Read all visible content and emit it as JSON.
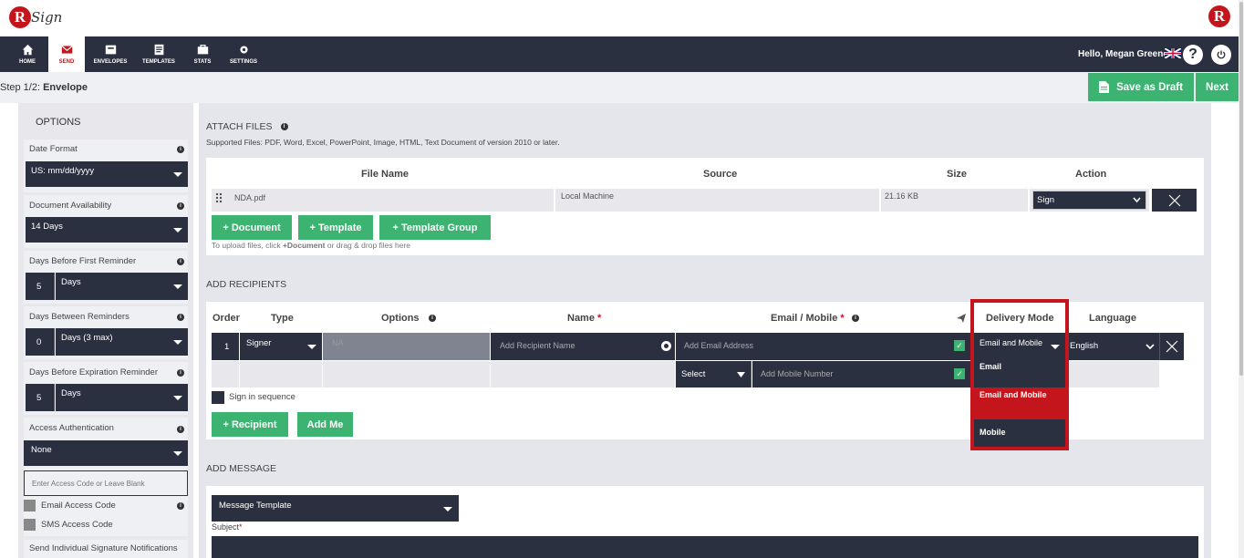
{
  "app": {
    "logo_letter": "R",
    "logo_word": "Sign"
  },
  "nav": {
    "items": [
      {
        "label": "HOME"
      },
      {
        "label": "SEND"
      },
      {
        "label": "ENVELOPES"
      },
      {
        "label": "TEMPLATES"
      },
      {
        "label": "STATS"
      },
      {
        "label": "SETTINGS"
      }
    ],
    "greeting": "Hello, Megan Greene"
  },
  "step": {
    "prefix": "Step 1/2: ",
    "name": "Envelope"
  },
  "actions": {
    "save_draft": "Save as Draft",
    "next": "Next"
  },
  "options": {
    "title": "OPTIONS",
    "date_format": {
      "label": "Date Format",
      "value": "US: mm/dd/yyyy"
    },
    "doc_availability": {
      "label": "Document Availability",
      "value": "14 Days"
    },
    "first_reminder": {
      "label": "Days Before First Reminder",
      "num": "5",
      "unit": "Days"
    },
    "between_reminders": {
      "label": "Days Between Reminders",
      "num": "0",
      "unit": "Days (3 max)"
    },
    "expiration_reminder": {
      "label": "Days Before Expiration Reminder",
      "num": "5",
      "unit": "Days"
    },
    "access_auth": {
      "label": "Access Authentication",
      "value": "None",
      "placeholder": "Enter Access Code or Leave Blank",
      "email_code": "Email Access Code",
      "sms_code": "SMS Access Code"
    },
    "individual_notifications": "Send Individual Signature Notifications"
  },
  "attach": {
    "title": "ATTACH FILES",
    "supported": "Supported Files: PDF, Word, Excel, PowerPoint, Image, HTML, Text Document of version 2010 or later.",
    "headers": {
      "file": "File Name",
      "source": "Source",
      "size": "Size",
      "action": "Action"
    },
    "files": [
      {
        "name": "NDA.pdf",
        "source": "Local Machine",
        "size": "21.16 KB",
        "action": "Sign"
      }
    ],
    "btn_document": "+ Document",
    "btn_template": "+ Template",
    "btn_template_group": "+ Template Group",
    "hint_pre": "To upload files, click ",
    "hint_bold": "+Document",
    "hint_post": " or drag & drop files here"
  },
  "recipients": {
    "title": "ADD RECIPIENTS",
    "headers": {
      "order": "Order",
      "type": "Type",
      "options": "Options",
      "name": "Name",
      "email": "Email / Mobile",
      "delivery": "Delivery Mode",
      "language": "Language"
    },
    "required": "*",
    "row": {
      "order": "1",
      "type": "Signer",
      "options": "NA",
      "name_placeholder": "Add Recipient Name",
      "email_placeholder": "Add Email Address",
      "select": "Select",
      "mobile_placeholder": "Add Mobile Number",
      "delivery": "Email and Mobile",
      "language": "English"
    },
    "delivery_options": [
      {
        "label": "Email"
      },
      {
        "label": "Email and Mobile"
      },
      {
        "label": "Mobile"
      }
    ],
    "sign_sequence": "Sign in sequence",
    "btn_recipient": "+ Recipient",
    "btn_addme": "Add Me"
  },
  "message": {
    "title": "ADD MESSAGE",
    "template": "Message Template",
    "subject": "Subject",
    "subject_req": "*"
  },
  "colors": {
    "brand_red": "#c4151c",
    "nav_dark": "#2b3040",
    "green": "#3cb371"
  }
}
